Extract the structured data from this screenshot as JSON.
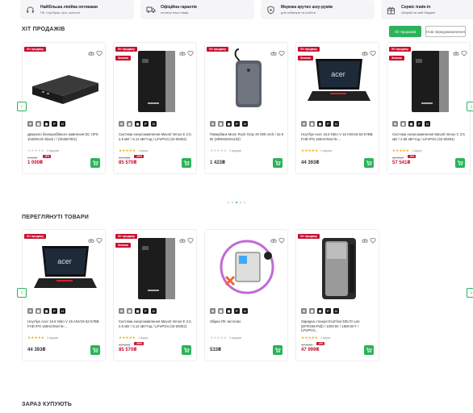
{
  "features": [
    {
      "title": "Найбільша лінійка оптиками",
      "sub": "ПК, ноутбуки, ігри, консолі",
      "icon": "headset-icon"
    },
    {
      "title": "Офіційна гарантія",
      "sub": "на весь наш товар",
      "icon": "delivery-truck-icon"
    },
    {
      "title": "Мережа крутих шоу-румів",
      "sub": "для геймерів та роботи",
      "icon": "shield-gear-icon"
    },
    {
      "title": "Сервіс trade-in",
      "sub": "обирай на свій бюджет",
      "icon": "gift-icon"
    }
  ],
  "bestsellers": {
    "title": "ХІТ ПРОДАЖІВ",
    "tab_hits": "Хіт продажів",
    "tab_preorder": "Нові передзамовлення",
    "products": [
      {
        "badge": "Хіт продажу",
        "badge2": "",
        "name": "Джерело безперебійного живлення DC UPS 10400mAh black / / (SKB57001)",
        "stars": "★★★★★",
        "starsGrey": true,
        "reviews": "0 відгуків",
        "old": "1 050₴",
        "disc": "-8%",
        "price": "1 000₴",
        "price_red": true
      },
      {
        "badge": "Хіт продажу",
        "badge2": "Знижка",
        "name": "Система енергоживлення Mavoti Venus E 3.0, 2.5 кВт / 5.12 кВт*год / LiFePO4 (42-00302)",
        "stars": "★★★★★",
        "starsGrey": false,
        "reviews": "1 відгук",
        "old": "94 999₴",
        "disc": "-10%",
        "price": "85 570₴",
        "price_red": true
      },
      {
        "badge": "Хіт продажу",
        "badge2": "",
        "name": "Павербанк Moon Rock Gray 20 000 mAh / 22.5 Вт (MRM20201102)",
        "stars": "★★★★★",
        "starsGrey": true,
        "reviews": "0 відгуків",
        "old": "",
        "disc": "",
        "price": "1 423₴",
        "price_red": false
      },
      {
        "badge": "Хіт продажу",
        "badge2": "Знижка",
        "name": "Ноутбук Acer 15.6 Nitro V 15 ANV15-52-57BB FHD IPS 165Hz/Intel i5-...",
        "stars": "★★★★★",
        "starsGrey": false,
        "reviews": "2 відгуки",
        "old": "",
        "disc": "",
        "price": "44 393₴",
        "price_red": false
      },
      {
        "badge": "Хіт продажу",
        "badge2": "Знижка",
        "name": "Система енергоживлення Mavoti Venus C 3.5 кВт / 2.56 кВт*год / LiFePO4 (42-00304)",
        "stars": "★★★★★",
        "starsGrey": false,
        "reviews": "1 відгук",
        "old": "62 999₴",
        "disc": "-9%",
        "price": "57 541₴",
        "price_red": true
      }
    ]
  },
  "viewed": {
    "title": "ПЕРЕГЛЯНУТІ ТОВАРИ",
    "products": [
      {
        "badge": "Хіт продажу",
        "badge2": "",
        "name": "Ноутбук Acer 15.6 Nitro V 15 ANV15-52-57BB FHD IPS 165Hz/Intel i5-...",
        "stars": "★★★★★",
        "starsGrey": false,
        "reviews": "2 відгуки",
        "old": "",
        "disc": "",
        "price": "44 393₴",
        "price_red": false
      },
      {
        "badge": "Хіт продажу",
        "badge2": "Знижка",
        "name": "Система енергоживлення Mavoti Venus E 3.0, 2.5 кВт / 5.12 кВт*год / LiFePO4 (42-00302)",
        "stars": "★★★★★",
        "starsGrey": false,
        "reviews": "1 відгук",
        "old": "94 999₴",
        "disc": "-10%",
        "price": "85 570₴",
        "price_red": true
      },
      {
        "badge": "",
        "badge2": "",
        "name": "Збірка ПК частково",
        "stars": "★★★★★",
        "starsGrey": true,
        "reviews": "0 відгуків",
        "old": "",
        "disc": "",
        "price": "533₴",
        "price_red": false
      },
      {
        "badge": "Хіт продажу",
        "badge2": "",
        "name": "Зарядна станція EcoFlow DELTA Lite (EFRX08-Pull) / 1000 Вт / 1800 Вт*г / LiFePO4...",
        "stars": "★★★★★",
        "starsGrey": false,
        "reviews": "1 відгук",
        "old": "49 999₴",
        "disc": "-4%",
        "price": "47 999₴",
        "price_red": true
      }
    ]
  },
  "now_buying": {
    "title": "ЗАРАЗ КУПУЮТЬ"
  }
}
